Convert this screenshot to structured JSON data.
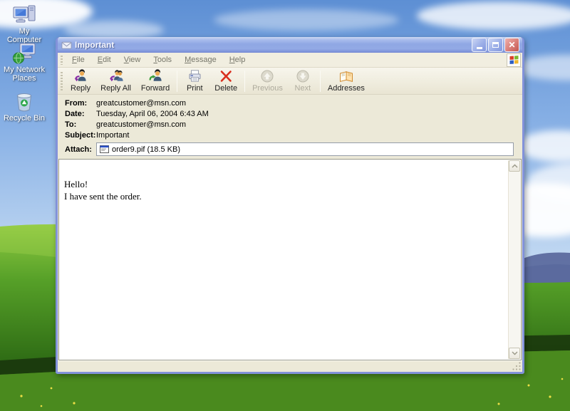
{
  "desktop": {
    "icons": [
      {
        "label": "My Computer"
      },
      {
        "label": "My Network Places"
      },
      {
        "label": "Recycle Bin"
      }
    ]
  },
  "window": {
    "title": "Important",
    "menu": {
      "items": [
        "File",
        "Edit",
        "View",
        "Tools",
        "Message",
        "Help"
      ]
    },
    "toolbar": {
      "reply": "Reply",
      "reply_all": "Reply All",
      "forward": "Forward",
      "print": "Print",
      "delete": "Delete",
      "previous": "Previous",
      "next": "Next",
      "addresses": "Addresses"
    },
    "headers": {
      "from": {
        "label": "From:",
        "value": "greatcustomer@msn.com"
      },
      "date": {
        "label": "Date:",
        "value": "Tuesday, April 06, 2004 6:43 AM"
      },
      "to": {
        "label": "To:",
        "value": "greatcustomer@msn.com"
      },
      "subject": {
        "label": "Subject:",
        "value": "Important"
      }
    },
    "attach": {
      "label": "Attach:",
      "value": "order9.pif (18.5 KB)"
    },
    "body": {
      "line1": "Hello!",
      "line2": "I have sent the order."
    }
  },
  "colors": {
    "titlebar_top": "#cdd8f2",
    "titlebar_bottom": "#6f82cf",
    "window_border": "#8292da",
    "chrome_face": "#ece9d8",
    "close_button": "#c25650",
    "delete_icon": "#d92f1e",
    "reply_arrow": "#8a2ea6",
    "forward_arrow": "#3a9e3a",
    "sky": "#5d8fd4",
    "grass": "#53a026"
  }
}
